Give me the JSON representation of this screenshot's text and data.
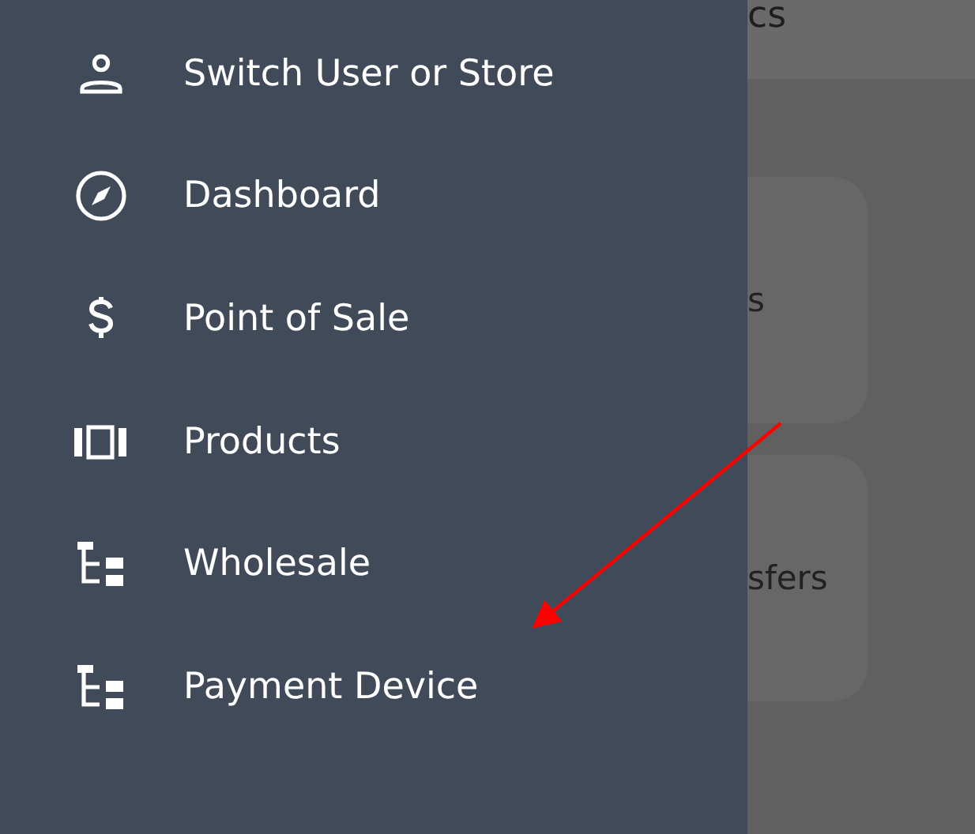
{
  "drawer": {
    "items": [
      {
        "kind": "person",
        "label": "Switch User or Store"
      },
      {
        "kind": "compass",
        "label": "Dashboard"
      },
      {
        "kind": "dollar",
        "label": "Point of Sale"
      },
      {
        "kind": "carousel",
        "label": "Products"
      },
      {
        "kind": "tree",
        "label": "Wholesale"
      },
      {
        "kind": "tree",
        "label": "Payment Device"
      }
    ]
  },
  "page": {
    "header_title": "cs",
    "cards": [
      {
        "label": "s"
      },
      {
        "label": "sfers"
      }
    ]
  }
}
